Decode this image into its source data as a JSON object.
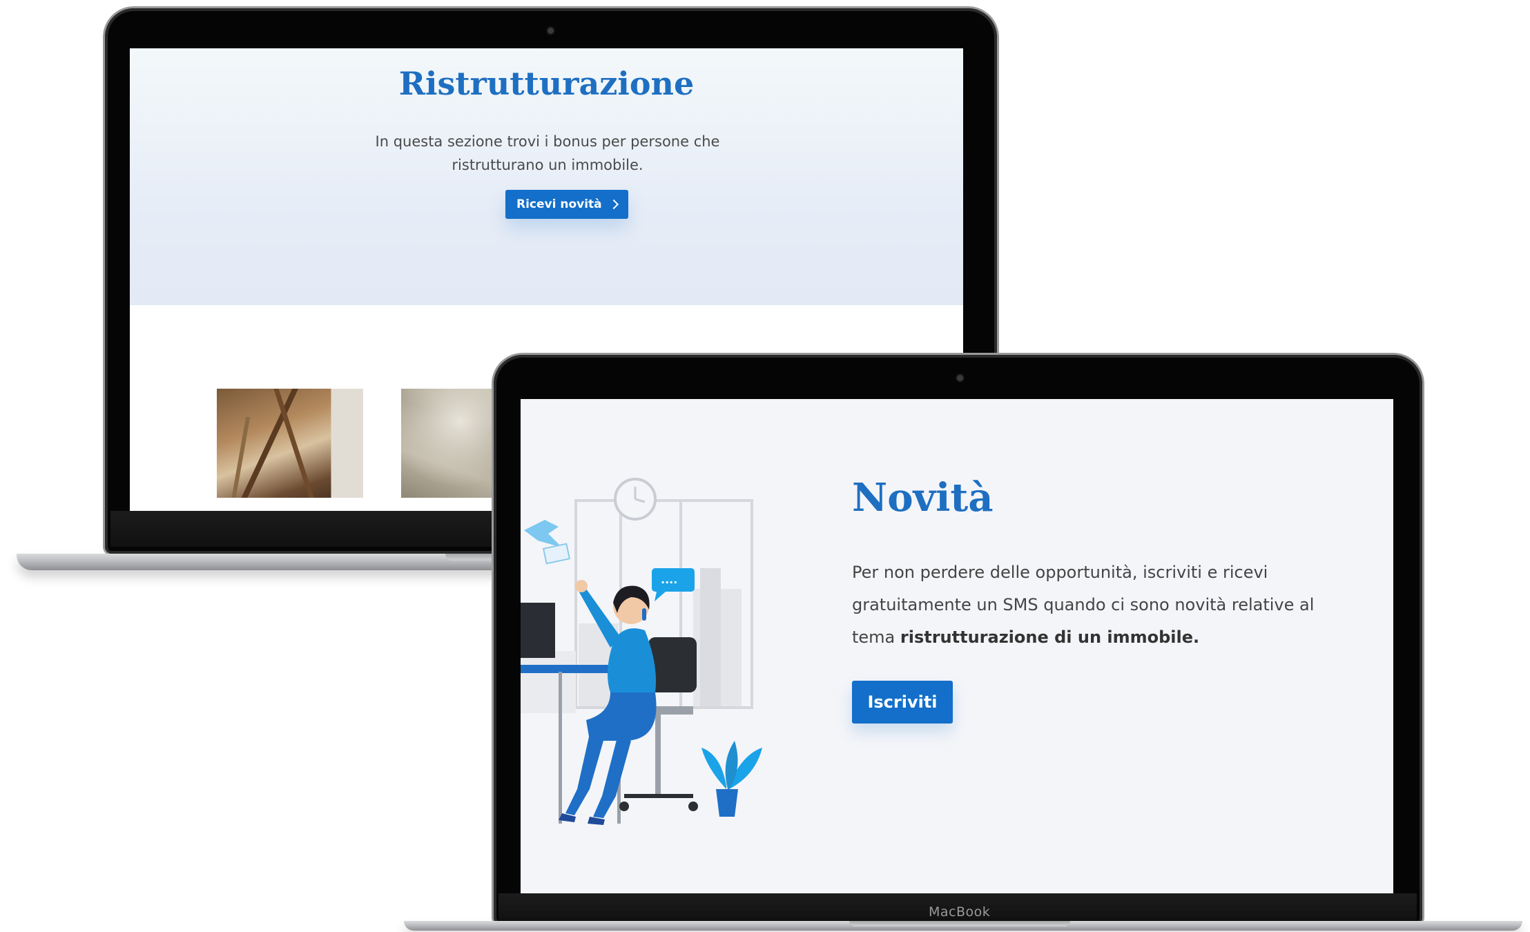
{
  "back_page": {
    "title": "Ristrutturazione",
    "description": "In questa sezione trovi i bonus per persone che ristrutturano un immobile.",
    "button_label": "Ricevi novità"
  },
  "front_page": {
    "title": "Novità",
    "description_plain": "Per non perdere delle opportunità, iscriviti e ricevi gratuitamente un SMS quando ci sono novità relative al tema ",
    "description_bold": "ristrutturazione di un immobile.",
    "button_label": "Iscriviti",
    "chat_bubble": "...."
  },
  "device": {
    "brand": "MacBook"
  },
  "colors": {
    "accent": "#136fc9",
    "title_blue": "#1e6fc1",
    "hero_bg": "#e7edf7",
    "page_bg": "#f4f5f9"
  },
  "icons": {
    "button_chevron": "chevron-right-icon",
    "illustration": "office-worker-illustration"
  }
}
